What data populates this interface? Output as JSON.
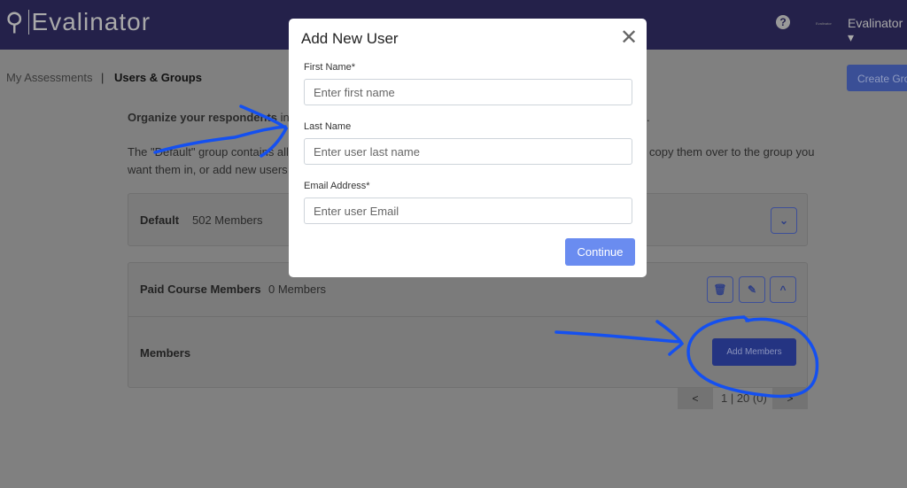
{
  "nav": {
    "logo": "Evalinator",
    "help_icon": "question-circle-icon",
    "tiny_label": "Evalinator",
    "user": "Evalinator ▾"
  },
  "breadcrumb": {
    "item1": "My Assessments",
    "sep": "|",
    "item2": "Users & Groups"
  },
  "create_group": "Create Group",
  "intro": {
    "line1_bold": "Organize your respondents",
    "line1_rest": " into",
    "line1_end": ".",
    "line2": "The \"Default\" group contains all",
    "line2_end": "copy them over to the group you",
    "line3": "want them in, or add new users"
  },
  "groups": [
    {
      "name": "Default",
      "count": "502 Members"
    },
    {
      "name": "Paid Course Members",
      "count": "0 Members"
    }
  ],
  "members_label": "Members",
  "add_members": "Add Members",
  "pagination": {
    "prev": "<",
    "info": "1 | 20 (0)",
    "next": ">"
  },
  "modal": {
    "title": "Add New User",
    "first_label": "First Name*",
    "first_ph": "Enter first name",
    "last_label": "Last Name",
    "last_ph": "Enter user last name",
    "email_label": "Email Address*",
    "email_ph": "Enter user Email",
    "continue": "Continue"
  },
  "colors": {
    "navbar": "#24214a",
    "accent": "#6a8cf0",
    "annotation": "#1450f0"
  }
}
